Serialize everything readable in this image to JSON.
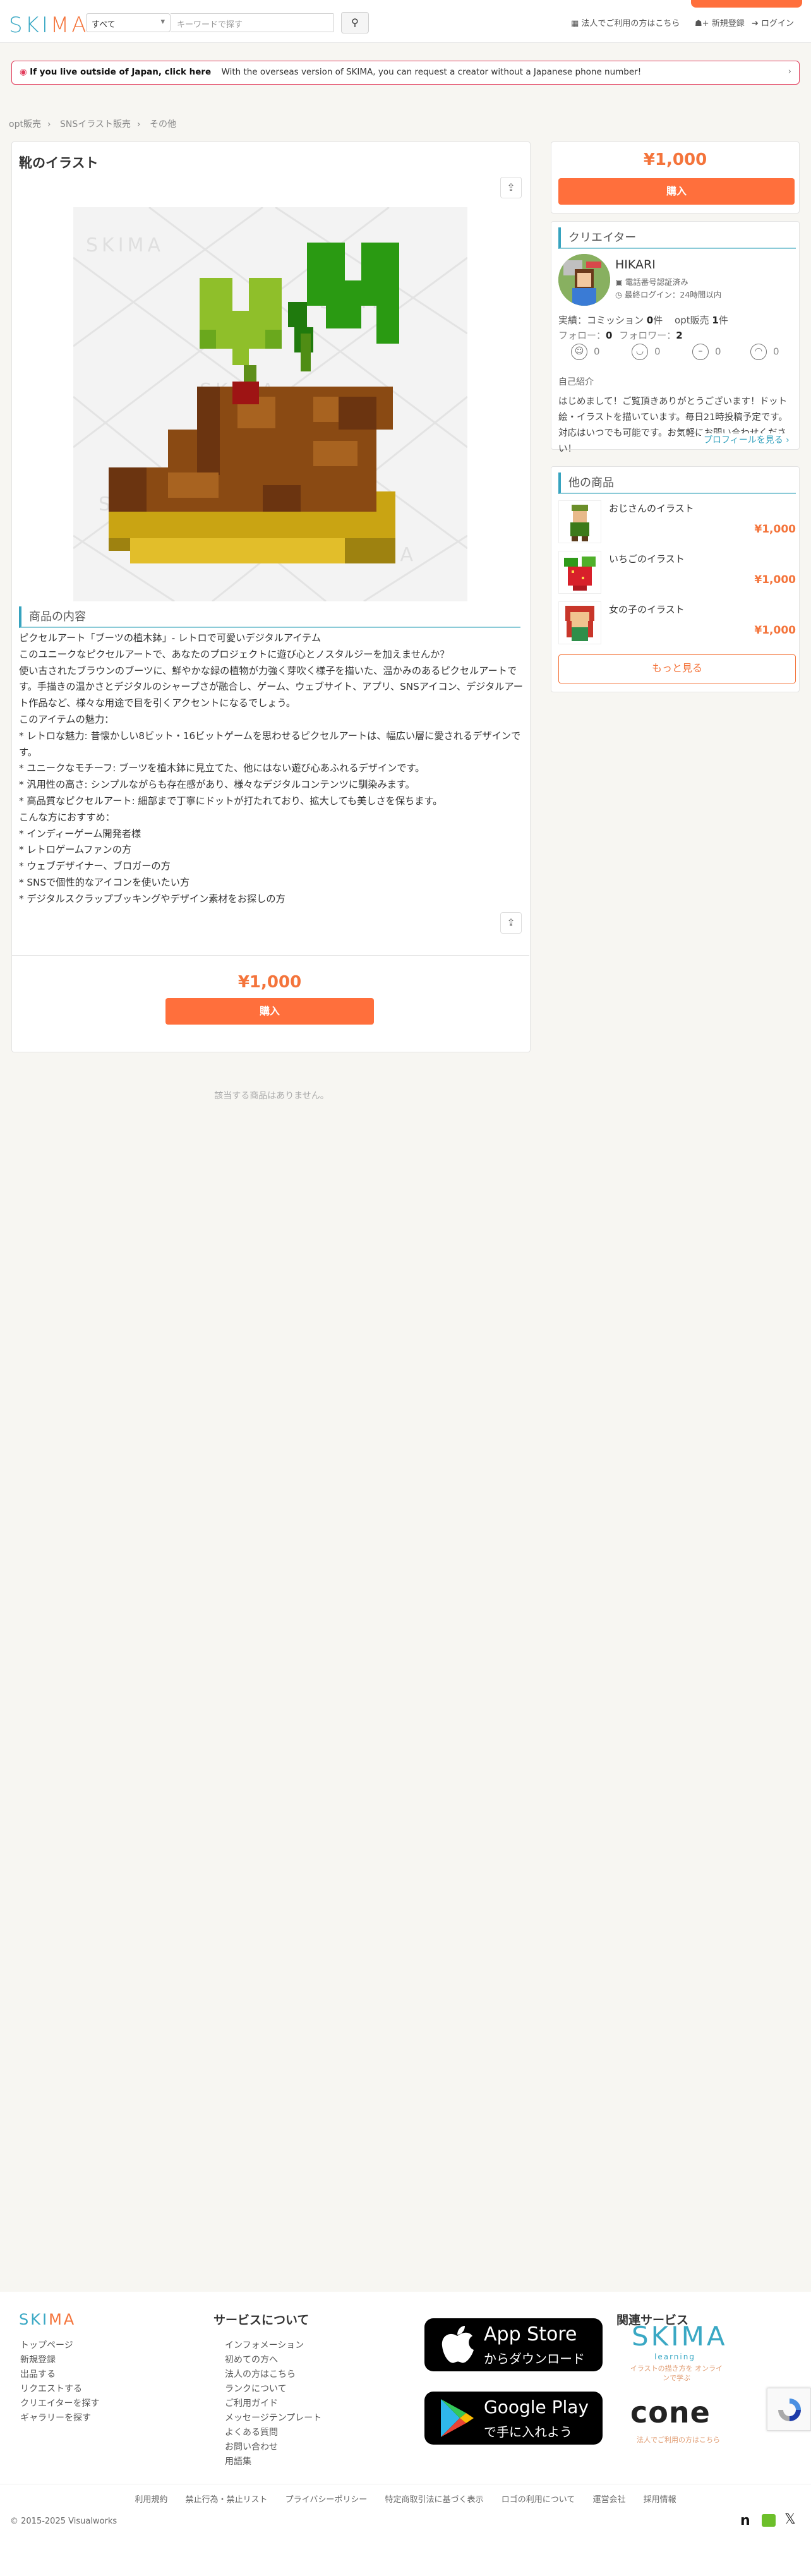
{
  "header": {
    "logo": "SKIMA",
    "search_select": "すべて",
    "search_placeholder": "キーワードで探す",
    "links": [
      "法人でご利用の方はこちら",
      "新規登録",
      "ログイン"
    ]
  },
  "notice": {
    "bold": "If you live outside of Japan, click here",
    "text": "With the overseas version of SKIMA, you can request a creator without a Japanese phone number!"
  },
  "breadcrumb": [
    "opt販売",
    "SNSイラスト販売",
    "その他"
  ],
  "product": {
    "title": "靴のイラスト",
    "section_heading": "商品の内容",
    "description": [
      "ピクセルアート「ブーツの植木鉢」- レトロで可愛いデジタルアイテム",
      "このユニークなピクセルアートで、あなたのプロジェクトに遊び心とノスタルジーを加えませんか？",
      "使い古されたブラウンのブーツに、鮮やかな緑の植物が力強く芽吹く様子を描いた、温かみのあるピクセルアートで",
      "す。手描きの温かさとデジタルのシャープさが融合し、ゲーム、ウェブサイト、アプリ、SNSアイコン、デジタルアー",
      "ト作品など、様々な用途で目を引くアクセントになるでしょう。",
      "このアイテムの魅力：",
      "* レトロな魅力: 昔懐かしい8ビット・16ビットゲームを思わせるピクセルアートは、幅広い層に愛されるデザインで",
      "す。",
      "* ユニークなモチーフ: ブーツを植木鉢に見立てた、他にはない遊び心あふれるデザインです。",
      "* 汎用性の高さ: シンプルながらも存在感があり、様々なデジタルコンテンツに馴染みます。",
      "* 高品質なピクセルアート: 細部まで丁寧にドットが打たれており、拡大しても美しさを保ちます。",
      "こんな方におすすめ：",
      "* インディーゲーム開発者様",
      "* レトロゲームファンの方",
      "* ウェブデザイナー、ブロガーの方",
      "* SNSで個性的なアイコンを使いたい方",
      "* デジタルスクラップブッキングやデザイン素材をお探しの方"
    ],
    "price": "¥1,000",
    "buy_label": "購入",
    "no_related": "該当する商品はありません。"
  },
  "sidebar": {
    "price": "¥1,000",
    "buy_label": "購入",
    "creator_heading": "クリエイター",
    "creator_name": "HIKARI",
    "phone_verified": "電話番号認証済み",
    "last_login": "最終ログイン：24時間以内",
    "stats_line": {
      "commission_label": "実績：コミッション",
      "commission_count": "0",
      "commission_unit": "件",
      "opt_label": "opt販売",
      "opt_count": "1",
      "opt_unit": "件"
    },
    "follow_line": {
      "follow_label": "フォロー：",
      "follow_count": "0",
      "follower_label": "フォロワー：",
      "follower_count": "2"
    },
    "feedback": [
      "0",
      "0",
      "0",
      "0"
    ],
    "intro_heading": "自己紹介",
    "intro_text": "はじめまして！ご覧頂きありがとうございます！ドット絵・イラストを描いています。毎日21時投稿予定です。対応はいつでも可能です。お気軽にお問い合わせください！",
    "profile_link": "プロフィールを見る ›",
    "other_heading": "他の商品",
    "others": [
      {
        "title": "おじさんのイラスト",
        "price": "¥1,000"
      },
      {
        "title": "いちごのイラスト",
        "price": "¥1,000"
      },
      {
        "title": "女の子のイラスト",
        "price": "¥1,000"
      }
    ],
    "more_label": "もっと見る"
  },
  "footer": {
    "logo": "SKIMA",
    "col1": [
      "トップページ",
      "新規登録",
      "出品する",
      "リクエストする",
      "クリエイターを探す",
      "ギャラリーを探す"
    ],
    "about_heading": "サービスについて",
    "col2": [
      "インフォメーション",
      "初めての方へ",
      "法人の方はこちら",
      "ランクについて",
      "ご利用ガイド",
      "メッセージテンプレート",
      "よくある質問",
      "お問い合わせ",
      "用語集"
    ],
    "appstore_big": "App Store",
    "appstore_sub": "からダウンロード",
    "gplay_big": "Google Play",
    "gplay_sub": "で手に入れよう",
    "related_heading": "関連サービス",
    "skima_learning": "SKIMA",
    "skima_learning_sub": "learning",
    "skima_learning_desc": "イラストの描き方を オンラインで学ぶ",
    "cone": "cone",
    "cone_desc": "法人でご利用の方はこちら",
    "bottom_links": [
      "利用規約",
      "禁止行為・禁止リスト",
      "プライバシーポリシー",
      "特定商取引法に基づく表示",
      "ロゴの利用について",
      "運営会社",
      "採用情報"
    ],
    "copyright": "© 2015-2025 Visualworks"
  },
  "colors": {
    "accent": "#ff6f3c",
    "brand": "#36a3bf"
  }
}
